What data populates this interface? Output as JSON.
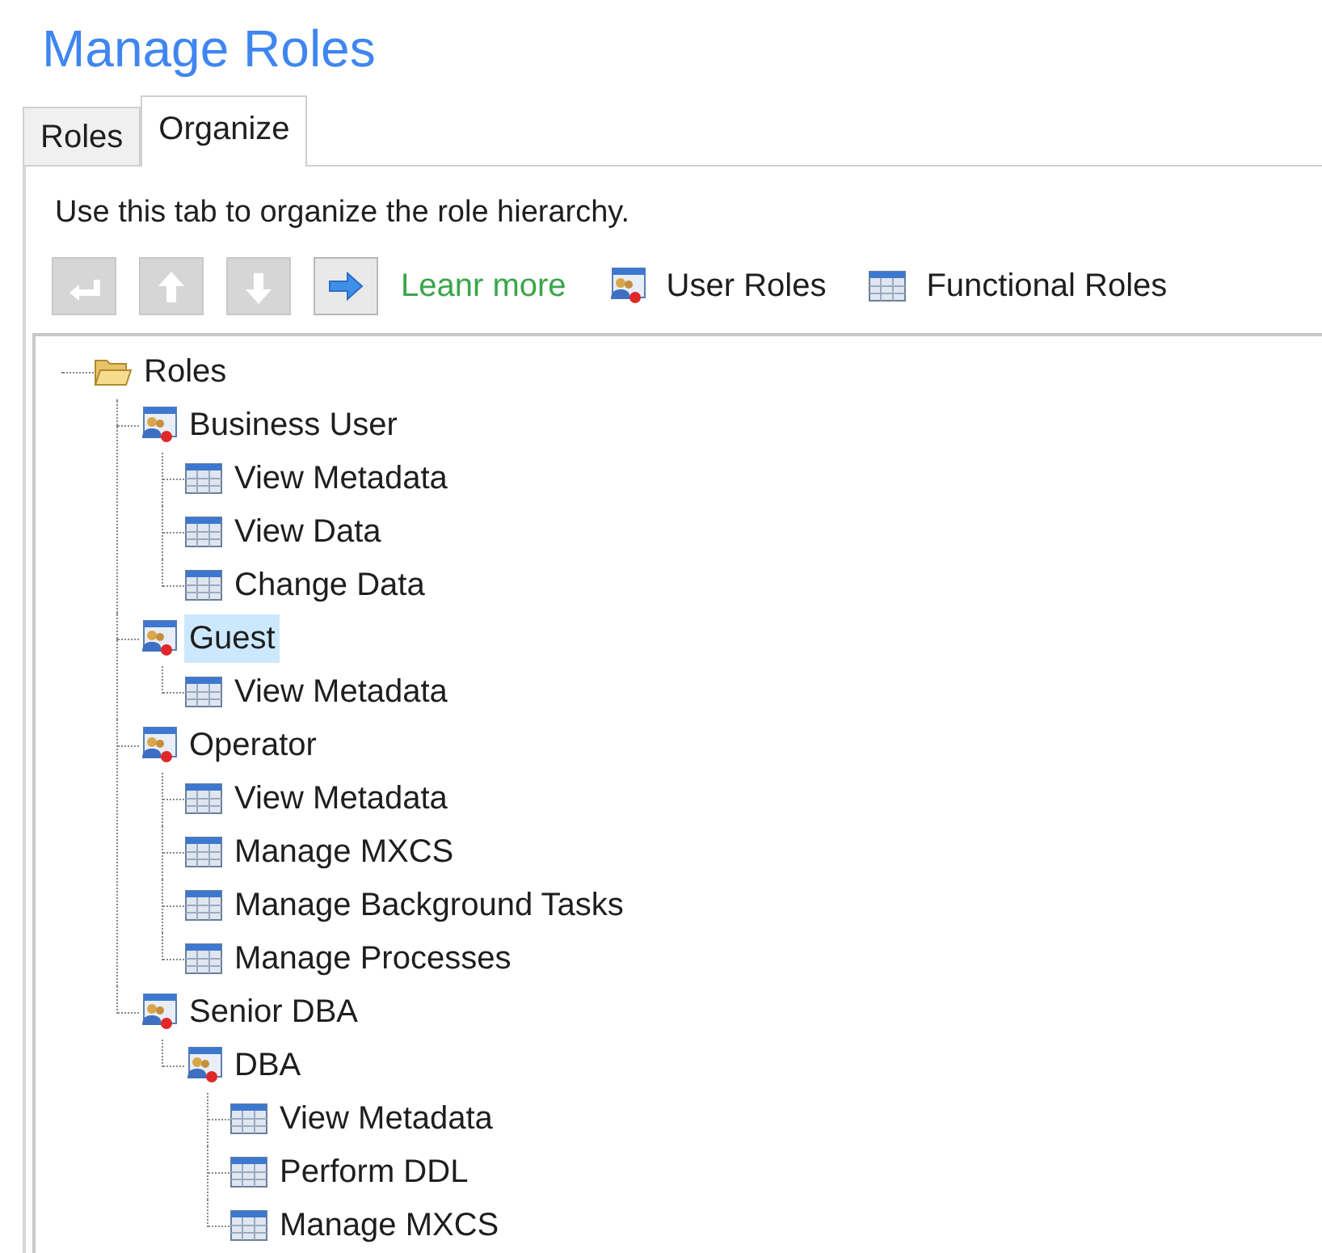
{
  "title": "Manage Roles",
  "tabs": [
    {
      "label": "Roles",
      "selected": false
    },
    {
      "label": "Organize",
      "selected": true
    }
  ],
  "description": "Use this tab to organize the role hierarchy.",
  "toolbar": {
    "icon_buttons": [
      {
        "kind": "indent",
        "disabled": true
      },
      {
        "kind": "up",
        "disabled": true
      },
      {
        "kind": "down",
        "disabled": true
      },
      {
        "kind": "right",
        "disabled": false
      }
    ],
    "link": "Leanr more",
    "buttons": [
      {
        "kind": "user-role",
        "label": "User Roles"
      },
      {
        "kind": "functional-role",
        "label": "Functional Roles"
      }
    ]
  },
  "tree": [
    {
      "kind": "folder",
      "label": "Roles",
      "selected": false,
      "children": [
        {
          "kind": "user-role",
          "label": "Business User",
          "selected": false,
          "children": [
            {
              "kind": "functional-role",
              "label": "View Metadata",
              "selected": false
            },
            {
              "kind": "functional-role",
              "label": "View Data",
              "selected": false
            },
            {
              "kind": "functional-role",
              "label": "Change Data",
              "selected": false
            }
          ]
        },
        {
          "kind": "user-role",
          "label": "Guest",
          "selected": true,
          "children": [
            {
              "kind": "functional-role",
              "label": "View Metadata",
              "selected": false
            }
          ]
        },
        {
          "kind": "user-role",
          "label": "Operator",
          "selected": false,
          "children": [
            {
              "kind": "functional-role",
              "label": "View Metadata",
              "selected": false
            },
            {
              "kind": "functional-role",
              "label": "Manage MXCS",
              "selected": false
            },
            {
              "kind": "functional-role",
              "label": "Manage Background Tasks",
              "selected": false
            },
            {
              "kind": "functional-role",
              "label": "Manage Processes",
              "selected": false
            }
          ]
        },
        {
          "kind": "user-role",
          "label": "Senior DBA",
          "selected": false,
          "children": [
            {
              "kind": "user-role",
              "label": "DBA",
              "selected": false,
              "children": [
                {
                  "kind": "functional-role",
                  "label": "View Metadata",
                  "selected": false
                },
                {
                  "kind": "functional-role",
                  "label": "Perform DDL",
                  "selected": false
                },
                {
                  "kind": "functional-role",
                  "label": "Manage MXCS",
                  "selected": false
                }
              ]
            }
          ]
        }
      ]
    }
  ]
}
